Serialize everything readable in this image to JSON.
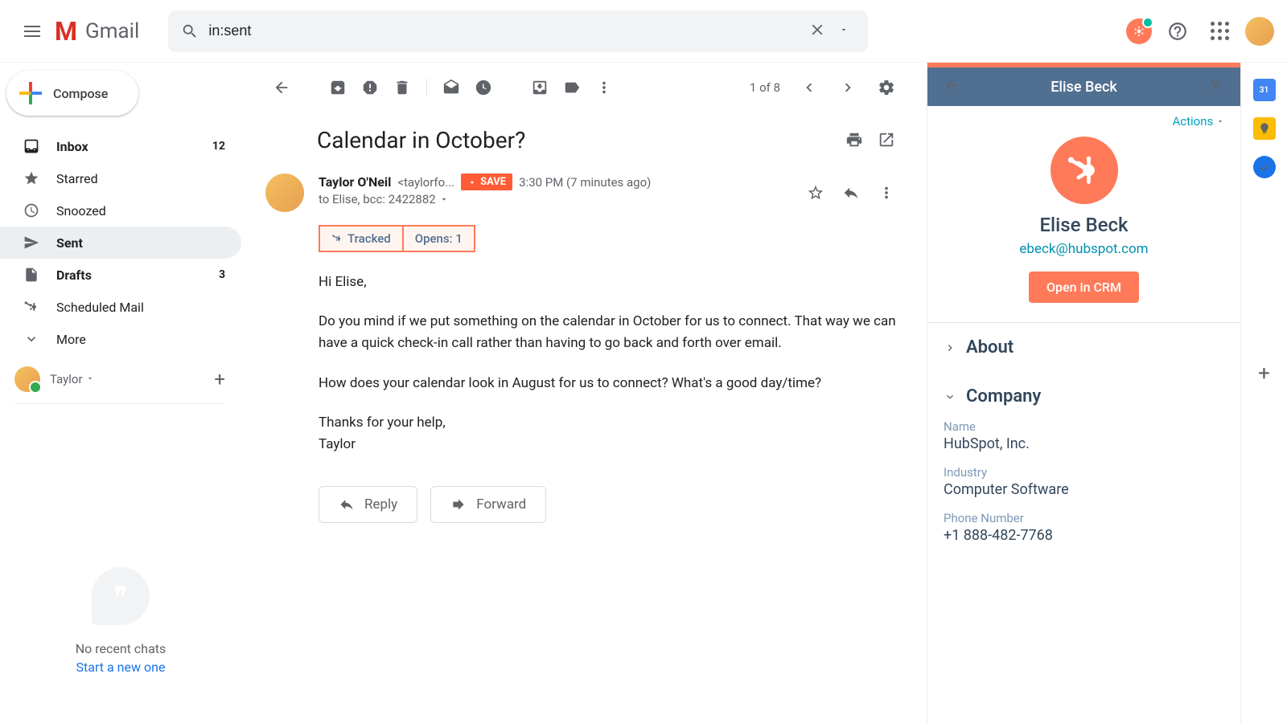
{
  "header": {
    "product_name": "Gmail",
    "search_value": "in:sent"
  },
  "compose_label": "Compose",
  "nav": {
    "inbox": {
      "label": "Inbox",
      "count": "12"
    },
    "starred": {
      "label": "Starred"
    },
    "snoozed": {
      "label": "Snoozed"
    },
    "sent": {
      "label": "Sent"
    },
    "drafts": {
      "label": "Drafts",
      "count": "3"
    },
    "scheduled": {
      "label": "Scheduled Mail"
    },
    "more": {
      "label": "More"
    }
  },
  "user": {
    "name": "Taylor"
  },
  "hangouts": {
    "no_chats": "No recent chats",
    "start": "Start a new one"
  },
  "toolbar": {
    "pagination": "1 of 8"
  },
  "email": {
    "subject": "Calendar in October?",
    "sender_name": "Taylor O'Neil",
    "sender_email": "<taylorfo...",
    "save_badge": "SAVE",
    "timestamp": "3:30 PM (7 minutes ago)",
    "recipients": "to Elise, bcc: 2422882",
    "tracked_label": "Tracked",
    "opens_label": "Opens: 1",
    "body_p1": "Hi Elise,",
    "body_p2": "Do you mind if we put something on the calendar in October for us to connect. That way we can have a quick check-in call rather than having to go back and forth over email.",
    "body_p3": "How does your calendar look in August for us to connect? What's a good day/time?",
    "body_p4": "Thanks for your help,\nTaylor",
    "reply_label": "Reply",
    "forward_label": "Forward"
  },
  "hubspot": {
    "header_title": "Elise Beck",
    "actions_label": "Actions",
    "contact_name": "Elise Beck",
    "contact_email": "ebeck@hubspot.com",
    "open_crm": "Open in CRM",
    "about_title": "About",
    "company_title": "Company",
    "company_name_label": "Name",
    "company_name_value": "HubSpot, Inc.",
    "industry_label": "Industry",
    "industry_value": "Computer Software",
    "phone_label": "Phone Number",
    "phone_value": "+1 888-482-7768"
  },
  "rail": {
    "calendar_day": "31"
  }
}
